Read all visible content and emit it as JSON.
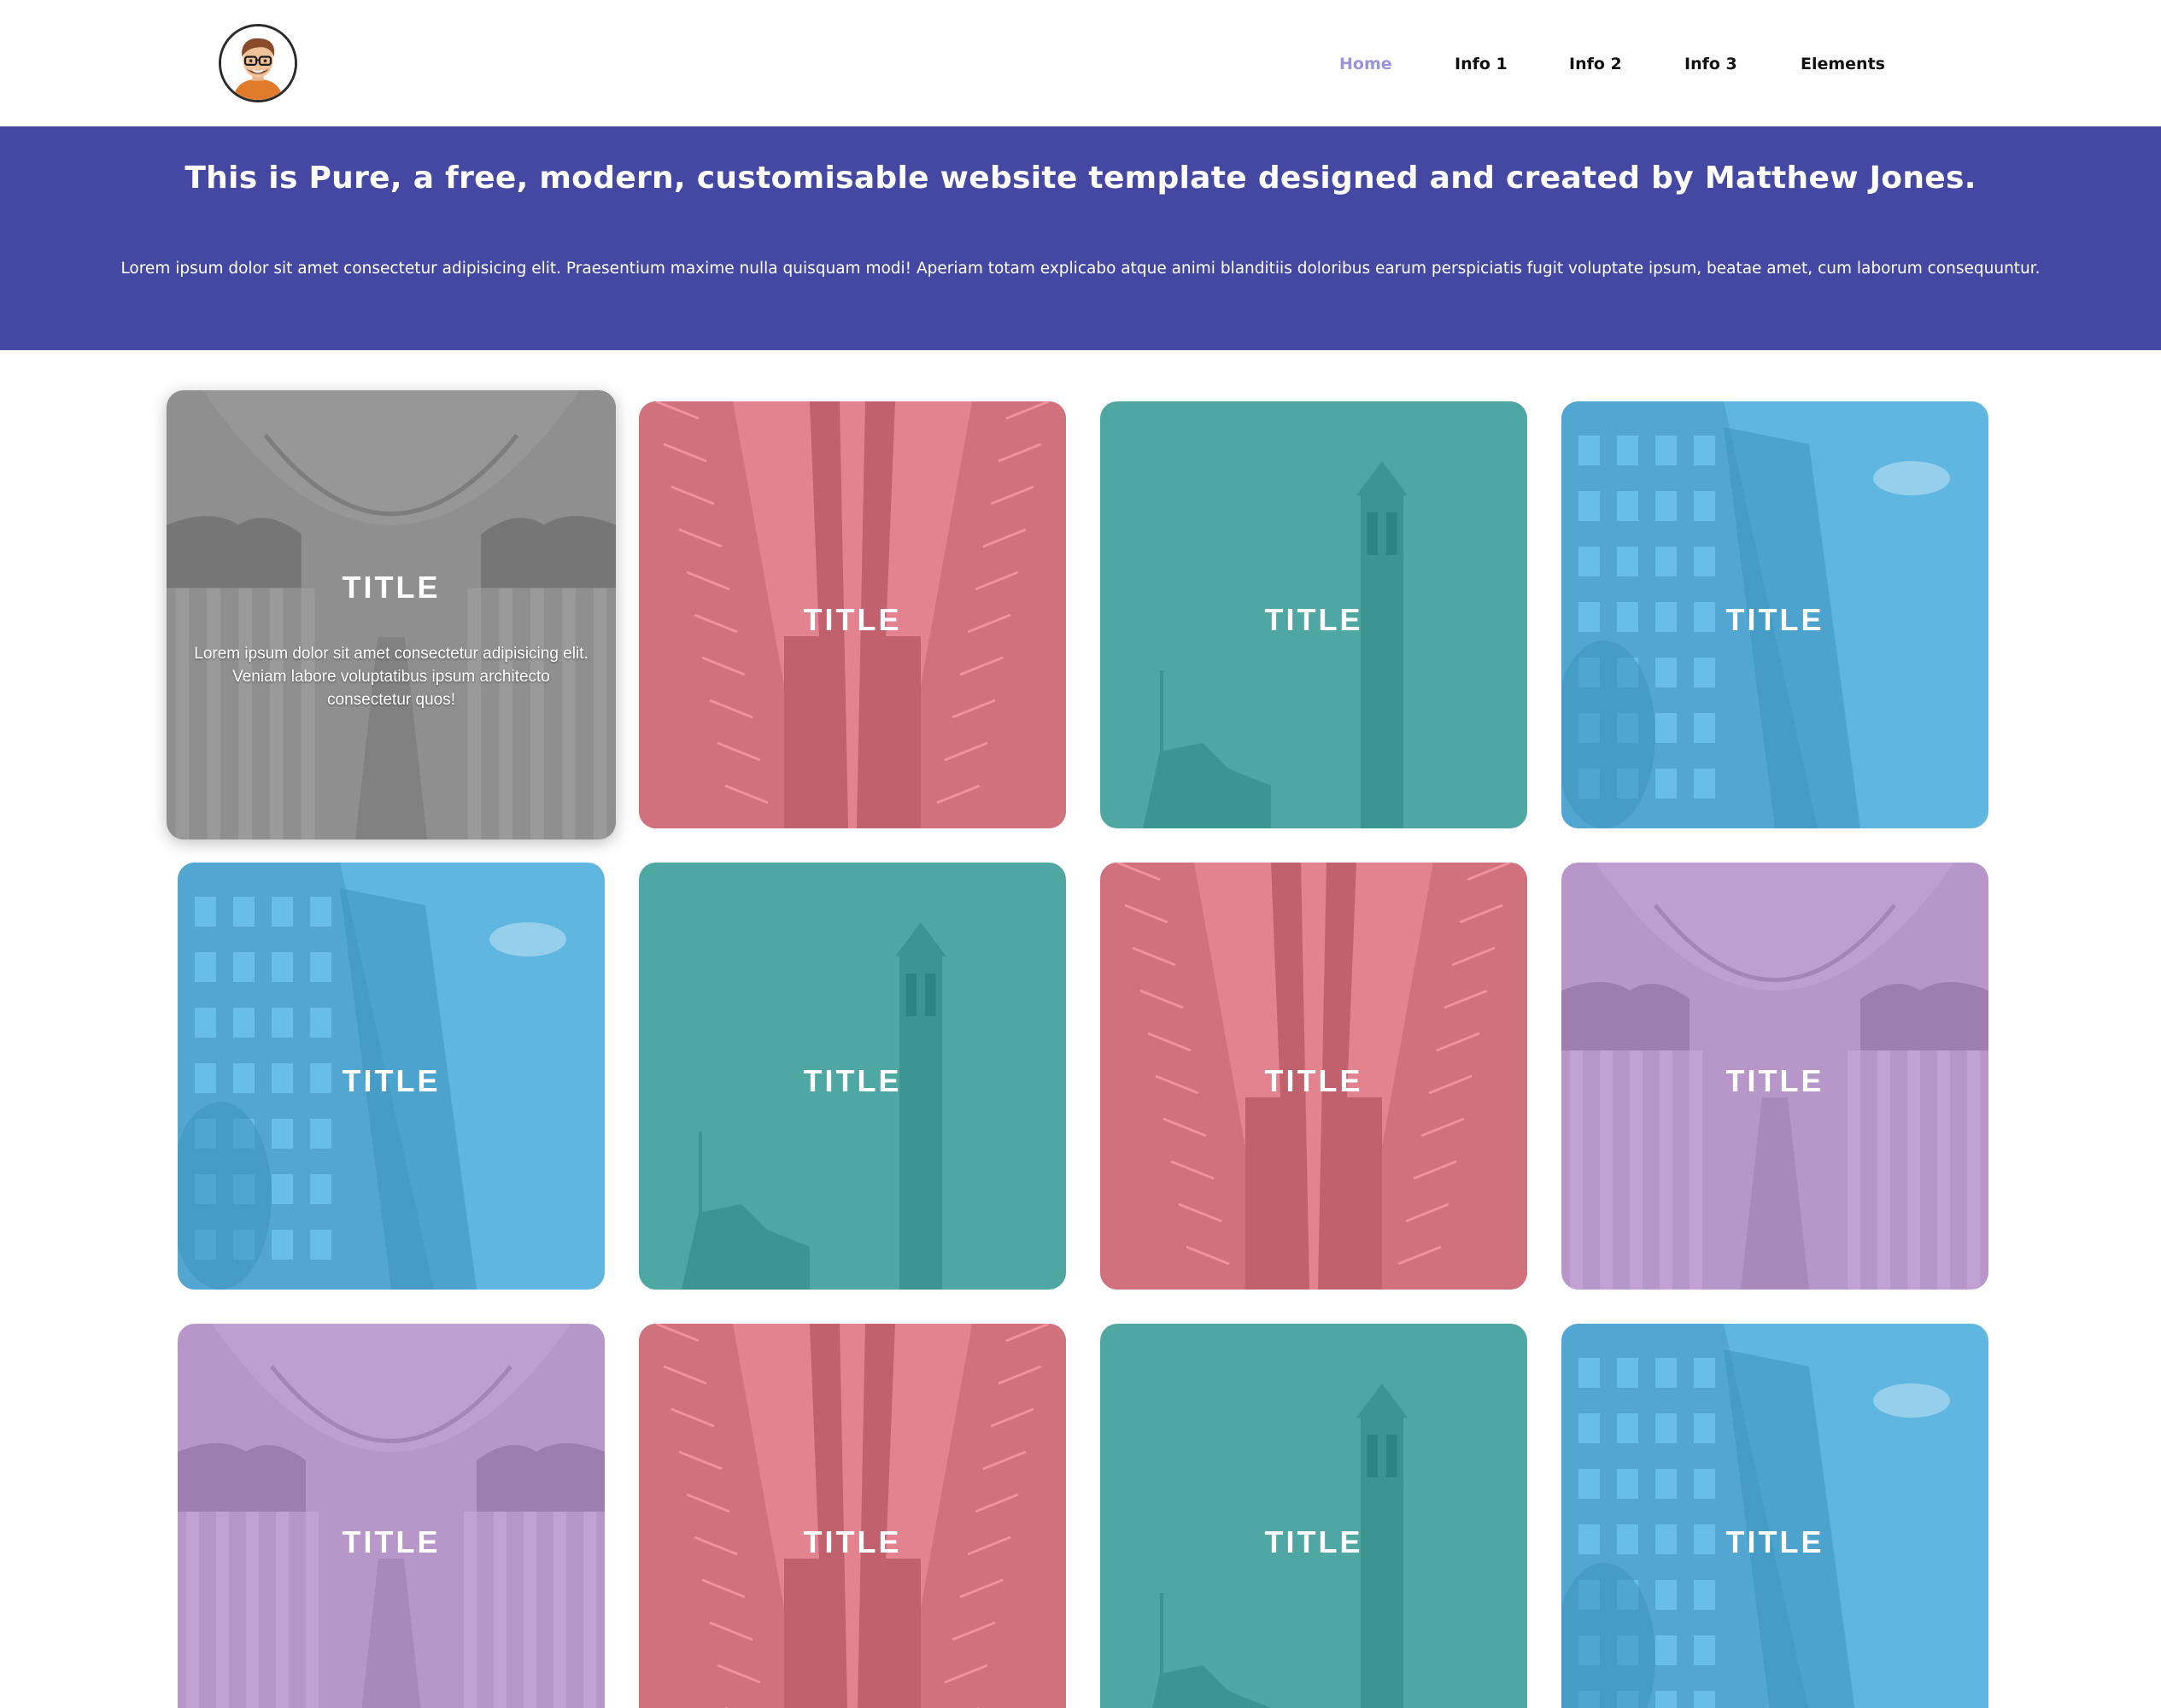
{
  "header": {
    "avatar_icon": "avatar-icon",
    "nav": [
      {
        "label": "Home",
        "active": true
      },
      {
        "label": "Info 1",
        "active": false
      },
      {
        "label": "Info 2",
        "active": false
      },
      {
        "label": "Info 3",
        "active": false
      },
      {
        "label": "Elements",
        "active": false
      }
    ]
  },
  "hero": {
    "title": "This is Pure, a free, modern, customisable website template designed and created by Matthew Jones.",
    "text": "Lorem ipsum dolor sit amet consectetur adipisicing elit. Praesentium maxime nulla quisquam modi! Aperiam totam explicabo atque animi blanditiis doloribus earum perspiciatis fugit voluptate ipsum, beatae amet, cum laborum consequuntur.",
    "background_color": "#4448a3"
  },
  "tiles": [
    {
      "title": "TITLE",
      "description": "Lorem ipsum dolor sit amet consectetur adipisicing elit. Veniam labore voluptatibus ipsum architecto consectetur quos!",
      "scene": "mosque",
      "color": "#8f8f8f",
      "hovered": true
    },
    {
      "title": "TITLE",
      "scene": "skyscraper",
      "color": "#e2838f"
    },
    {
      "title": "TITLE",
      "scene": "tower",
      "color": "#4fa7a4"
    },
    {
      "title": "TITLE",
      "scene": "houses",
      "color": "#5fb6e0"
    },
    {
      "title": "TITLE",
      "scene": "houses",
      "color": "#5fb6e0"
    },
    {
      "title": "TITLE",
      "scene": "tower",
      "color": "#4fa7a4"
    },
    {
      "title": "TITLE",
      "scene": "skyscraper",
      "color": "#e2838f"
    },
    {
      "title": "TITLE",
      "scene": "mosque",
      "color": "#b797c9"
    },
    {
      "title": "TITLE",
      "scene": "mosque",
      "color": "#b797c9"
    },
    {
      "title": "TITLE",
      "scene": "skyscraper",
      "color": "#e2838f"
    },
    {
      "title": "TITLE",
      "scene": "tower",
      "color": "#4fa7a4"
    },
    {
      "title": "TITLE",
      "scene": "houses",
      "color": "#5fb6e0"
    }
  ]
}
